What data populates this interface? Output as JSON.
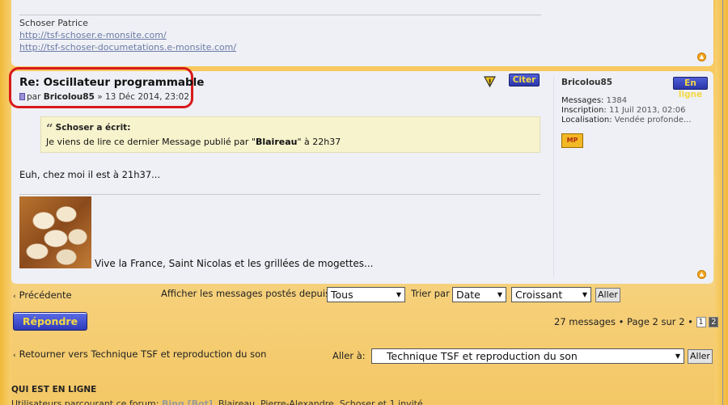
{
  "prev_post": {
    "signature_name": "Schoser Patrice",
    "link1": "http://tsf-schoser.e-monsite.com/",
    "link2": "http://tsf-schoser-documetations.e-monsite.com/"
  },
  "post": {
    "title": "Re: Oscillateur programmable",
    "meta_by": "par",
    "author_link": "Bricolou85",
    "meta_date": "» 13 Déc 2014, 23:02",
    "quote_button": "Citer",
    "quote": {
      "author_line": "Schoser a écrit:",
      "text_before": "Je viens de lire ce dernier Message publié par \"",
      "text_bold": "Blaireau",
      "text_after": "\" à 22h37"
    },
    "body": "Euh, chez moi il est à 21h37...",
    "signature_text": "Vive la France, Saint Nicolas et les grillées de mogettes..."
  },
  "profile": {
    "username": "Bricolou85",
    "online_badge": "En ligne",
    "messages_label": "Messages:",
    "messages_value": "1384",
    "inscription_label": "Inscription:",
    "inscription_value": "11 Juil 2013, 02:06",
    "localisation_label": "Localisation:",
    "localisation_value": "Vendée profonde...",
    "pm_icon_label": "MP"
  },
  "nav": {
    "previous": "Précédente",
    "display_label": "Afficher les messages postés depuis:",
    "display_value": "Tous",
    "sort_label": "Trier par",
    "sort_value": "Date",
    "order_value": "Croissant",
    "go_button": "Aller"
  },
  "actions": {
    "reply_button": "Répondre",
    "pagination_text": "27 messages • Page 2 sur 2 •",
    "pages": [
      "1",
      "2"
    ]
  },
  "footer_nav": {
    "back_link": "Retourner vers Technique TSF et reproduction du son",
    "jump_label": "Aller à:",
    "jump_value": "Technique TSF et reproduction du son",
    "jump_button": "Aller"
  },
  "who_is_online": {
    "title": "QUI EST EN LIGNE",
    "prefix": "Utilisateurs parcourant ce forum: ",
    "bot": "Bing [Bot]",
    "rest": ", Blaireau, Pierre-Alexandre, Schoser et 1 invité"
  },
  "colors": {
    "accent_button": "#2f3ab8",
    "button_text": "#f5d842",
    "highlight_ring": "#d81a1a"
  }
}
